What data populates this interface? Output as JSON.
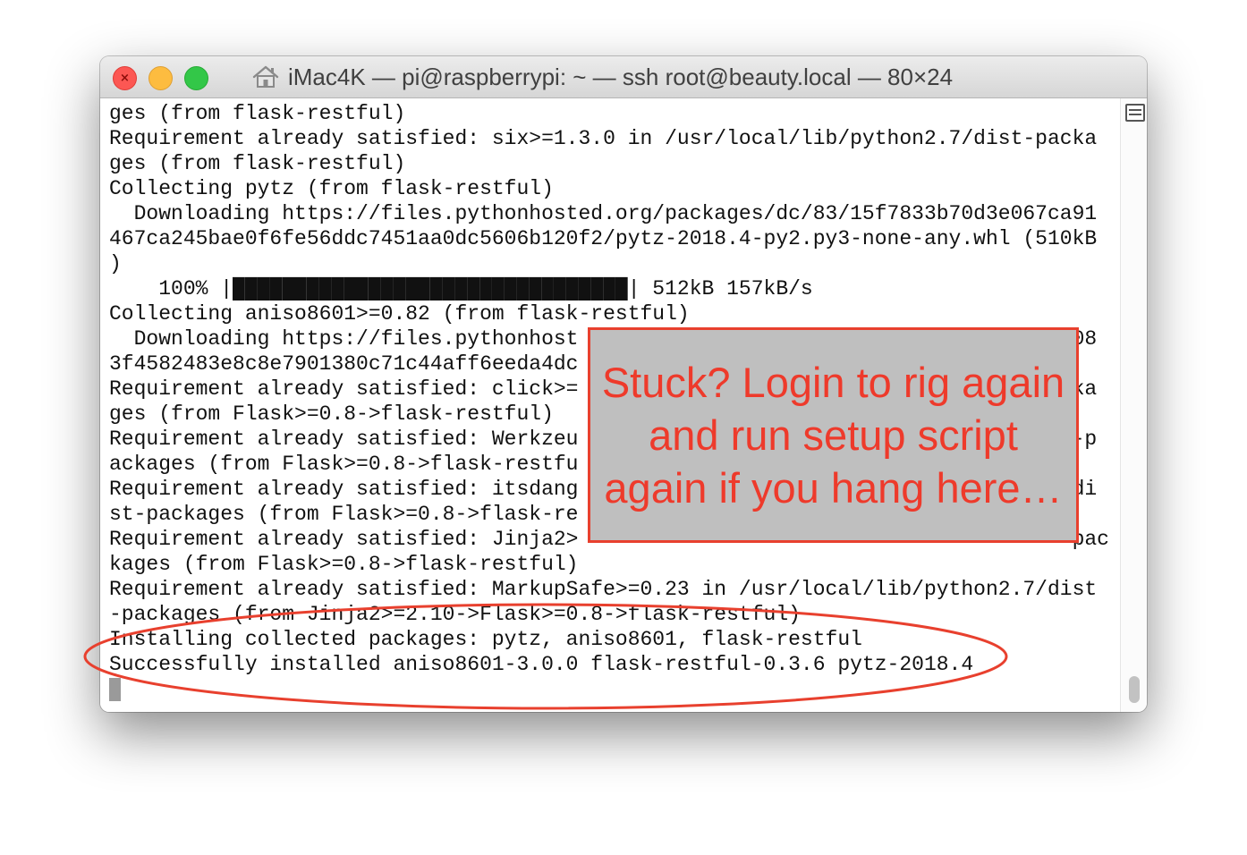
{
  "window": {
    "title": "iMac4K — pi@raspberrypi: ~ — ssh root@beauty.local — 80×24"
  },
  "terminal": {
    "lines": [
      "ges (from flask-restful)",
      "Requirement already satisfied: six>=1.3.0 in /usr/local/lib/python2.7/dist-packa",
      "ges (from flask-restful)",
      "Collecting pytz (from flask-restful)",
      "  Downloading https://files.pythonhosted.org/packages/dc/83/15f7833b70d3e067ca91",
      "467ca245bae0f6fe56ddc7451aa0dc5606b120f2/pytz-2018.4-py2.py3-none-any.whl (510kB",
      ")",
      "    100% |████████████████████████████████| 512kB 157kB/s",
      "Collecting aniso8601>=0.82 (from flask-restful)",
      "  Downloading https://files.pythonhost                                        08",
      "3f4582483e8c8e7901380c71c44aff6eeda4dc",
      "Requirement already satisfied: click>=                                        ka",
      "ges (from Flask>=0.8->flask-restful)",
      "Requirement already satisfied: Werkzeu                                        -p",
      "ackages (from Flask>=0.8->flask-restfu",
      "Requirement already satisfied: itsdang                                        di",
      "st-packages (from Flask>=0.8->flask-re",
      "Requirement already satisfied: Jinja2>                                        pac",
      "kages (from Flask>=0.8->flask-restful)",
      "Requirement already satisfied: MarkupSafe>=0.23 in /usr/local/lib/python2.7/dist",
      "-packages (from Jinja2>=2.10->Flask>=0.8->flask-restful)",
      "Installing collected packages: pytz, aniso8601, flask-restful",
      "Successfully installed aniso8601-3.0.0 flask-restful-0.3.6 pytz-2018.4"
    ]
  },
  "callout": {
    "text": "Stuck?  Login to rig again and run setup script again if you hang here…"
  },
  "colors": {
    "annotation": "#ee3a2b",
    "callout_bg": "#bfbfbf",
    "close": "#fc5753",
    "minimize": "#fdbc40",
    "maximize": "#33c748"
  }
}
